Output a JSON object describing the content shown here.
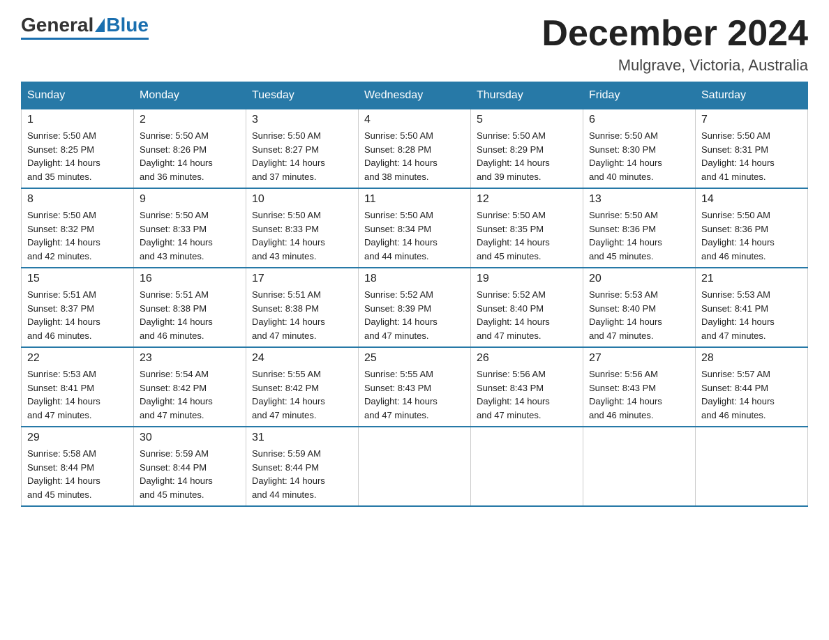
{
  "header": {
    "logo_text_general": "General",
    "logo_text_blue": "Blue",
    "month_title": "December 2024",
    "location": "Mulgrave, Victoria, Australia"
  },
  "days_of_week": [
    "Sunday",
    "Monday",
    "Tuesday",
    "Wednesday",
    "Thursday",
    "Friday",
    "Saturday"
  ],
  "weeks": [
    [
      {
        "day": "1",
        "sunrise": "5:50 AM",
        "sunset": "8:25 PM",
        "daylight": "14 hours and 35 minutes."
      },
      {
        "day": "2",
        "sunrise": "5:50 AM",
        "sunset": "8:26 PM",
        "daylight": "14 hours and 36 minutes."
      },
      {
        "day": "3",
        "sunrise": "5:50 AM",
        "sunset": "8:27 PM",
        "daylight": "14 hours and 37 minutes."
      },
      {
        "day": "4",
        "sunrise": "5:50 AM",
        "sunset": "8:28 PM",
        "daylight": "14 hours and 38 minutes."
      },
      {
        "day": "5",
        "sunrise": "5:50 AM",
        "sunset": "8:29 PM",
        "daylight": "14 hours and 39 minutes."
      },
      {
        "day": "6",
        "sunrise": "5:50 AM",
        "sunset": "8:30 PM",
        "daylight": "14 hours and 40 minutes."
      },
      {
        "day": "7",
        "sunrise": "5:50 AM",
        "sunset": "8:31 PM",
        "daylight": "14 hours and 41 minutes."
      }
    ],
    [
      {
        "day": "8",
        "sunrise": "5:50 AM",
        "sunset": "8:32 PM",
        "daylight": "14 hours and 42 minutes."
      },
      {
        "day": "9",
        "sunrise": "5:50 AM",
        "sunset": "8:33 PM",
        "daylight": "14 hours and 43 minutes."
      },
      {
        "day": "10",
        "sunrise": "5:50 AM",
        "sunset": "8:33 PM",
        "daylight": "14 hours and 43 minutes."
      },
      {
        "day": "11",
        "sunrise": "5:50 AM",
        "sunset": "8:34 PM",
        "daylight": "14 hours and 44 minutes."
      },
      {
        "day": "12",
        "sunrise": "5:50 AM",
        "sunset": "8:35 PM",
        "daylight": "14 hours and 45 minutes."
      },
      {
        "day": "13",
        "sunrise": "5:50 AM",
        "sunset": "8:36 PM",
        "daylight": "14 hours and 45 minutes."
      },
      {
        "day": "14",
        "sunrise": "5:50 AM",
        "sunset": "8:36 PM",
        "daylight": "14 hours and 46 minutes."
      }
    ],
    [
      {
        "day": "15",
        "sunrise": "5:51 AM",
        "sunset": "8:37 PM",
        "daylight": "14 hours and 46 minutes."
      },
      {
        "day": "16",
        "sunrise": "5:51 AM",
        "sunset": "8:38 PM",
        "daylight": "14 hours and 46 minutes."
      },
      {
        "day": "17",
        "sunrise": "5:51 AM",
        "sunset": "8:38 PM",
        "daylight": "14 hours and 47 minutes."
      },
      {
        "day": "18",
        "sunrise": "5:52 AM",
        "sunset": "8:39 PM",
        "daylight": "14 hours and 47 minutes."
      },
      {
        "day": "19",
        "sunrise": "5:52 AM",
        "sunset": "8:40 PM",
        "daylight": "14 hours and 47 minutes."
      },
      {
        "day": "20",
        "sunrise": "5:53 AM",
        "sunset": "8:40 PM",
        "daylight": "14 hours and 47 minutes."
      },
      {
        "day": "21",
        "sunrise": "5:53 AM",
        "sunset": "8:41 PM",
        "daylight": "14 hours and 47 minutes."
      }
    ],
    [
      {
        "day": "22",
        "sunrise": "5:53 AM",
        "sunset": "8:41 PM",
        "daylight": "14 hours and 47 minutes."
      },
      {
        "day": "23",
        "sunrise": "5:54 AM",
        "sunset": "8:42 PM",
        "daylight": "14 hours and 47 minutes."
      },
      {
        "day": "24",
        "sunrise": "5:55 AM",
        "sunset": "8:42 PM",
        "daylight": "14 hours and 47 minutes."
      },
      {
        "day": "25",
        "sunrise": "5:55 AM",
        "sunset": "8:43 PM",
        "daylight": "14 hours and 47 minutes."
      },
      {
        "day": "26",
        "sunrise": "5:56 AM",
        "sunset": "8:43 PM",
        "daylight": "14 hours and 47 minutes."
      },
      {
        "day": "27",
        "sunrise": "5:56 AM",
        "sunset": "8:43 PM",
        "daylight": "14 hours and 46 minutes."
      },
      {
        "day": "28",
        "sunrise": "5:57 AM",
        "sunset": "8:44 PM",
        "daylight": "14 hours and 46 minutes."
      }
    ],
    [
      {
        "day": "29",
        "sunrise": "5:58 AM",
        "sunset": "8:44 PM",
        "daylight": "14 hours and 45 minutes."
      },
      {
        "day": "30",
        "sunrise": "5:59 AM",
        "sunset": "8:44 PM",
        "daylight": "14 hours and 45 minutes."
      },
      {
        "day": "31",
        "sunrise": "5:59 AM",
        "sunset": "8:44 PM",
        "daylight": "14 hours and 44 minutes."
      },
      null,
      null,
      null,
      null
    ]
  ],
  "labels": {
    "sunrise": "Sunrise:",
    "sunset": "Sunset:",
    "daylight": "Daylight:"
  }
}
